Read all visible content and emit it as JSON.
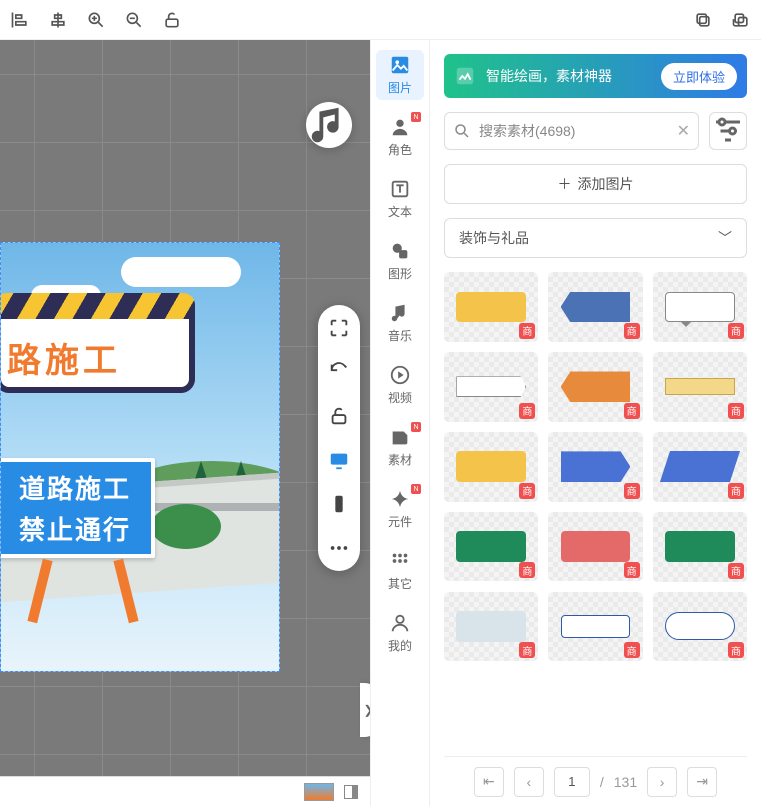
{
  "top_toolbar_icons": [
    "align-left",
    "align-center",
    "zoom-in",
    "zoom-out",
    "unlock",
    "copy",
    "copy-group"
  ],
  "canvas": {
    "sign_yellow_text": "路施工",
    "sign_blue_line1": "道路施工",
    "sign_blue_line2": "禁止通行"
  },
  "nav": {
    "items": [
      {
        "key": "image",
        "label": "图片",
        "badge": null
      },
      {
        "key": "role",
        "label": "角色",
        "badge": "N"
      },
      {
        "key": "text",
        "label": "文本",
        "badge": null
      },
      {
        "key": "shape",
        "label": "图形",
        "badge": null
      },
      {
        "key": "music",
        "label": "音乐",
        "badge": null
      },
      {
        "key": "video",
        "label": "视频",
        "badge": null
      },
      {
        "key": "material",
        "label": "素材",
        "badge": "N"
      },
      {
        "key": "component",
        "label": "元件",
        "badge": "N"
      },
      {
        "key": "other",
        "label": "其它",
        "badge": null
      },
      {
        "key": "mine",
        "label": "我的",
        "badge": null
      }
    ],
    "active": "image"
  },
  "promo": {
    "text": "智能绘画，素材神器",
    "button": "立即体验"
  },
  "search": {
    "placeholder": "搜索素材(4698)"
  },
  "add_image_label": "添加图片",
  "category": {
    "selected": "装饰与礼品"
  },
  "assets": [
    {
      "color": "#f3c34a",
      "style": "solid"
    },
    {
      "color": "#4a72b4",
      "style": "arrow-left"
    },
    {
      "color": "#ffffff",
      "style": "bubble"
    },
    {
      "color": "#ffffff",
      "style": "tag"
    },
    {
      "color": "#e88a3b",
      "style": "arrow-left"
    },
    {
      "color": "#f3d88a",
      "style": "thin"
    },
    {
      "color": "#f3c34a",
      "style": "solid"
    },
    {
      "color": "#4a72d4",
      "style": "arrow-right"
    },
    {
      "color": "#4a72d4",
      "style": "para"
    },
    {
      "color": "#1f8a5a",
      "style": "solid"
    },
    {
      "color": "#e46a6a",
      "style": "solid"
    },
    {
      "color": "#1f8a5a",
      "style": "solid"
    },
    {
      "color": "#d8e3ea",
      "style": "solid"
    },
    {
      "color": "#ffffff",
      "style": "outline-pill"
    },
    {
      "color": "#ffffff",
      "style": "pill"
    }
  ],
  "asset_tag": "商",
  "pager": {
    "current": "1",
    "total": "131",
    "sep": "/"
  }
}
